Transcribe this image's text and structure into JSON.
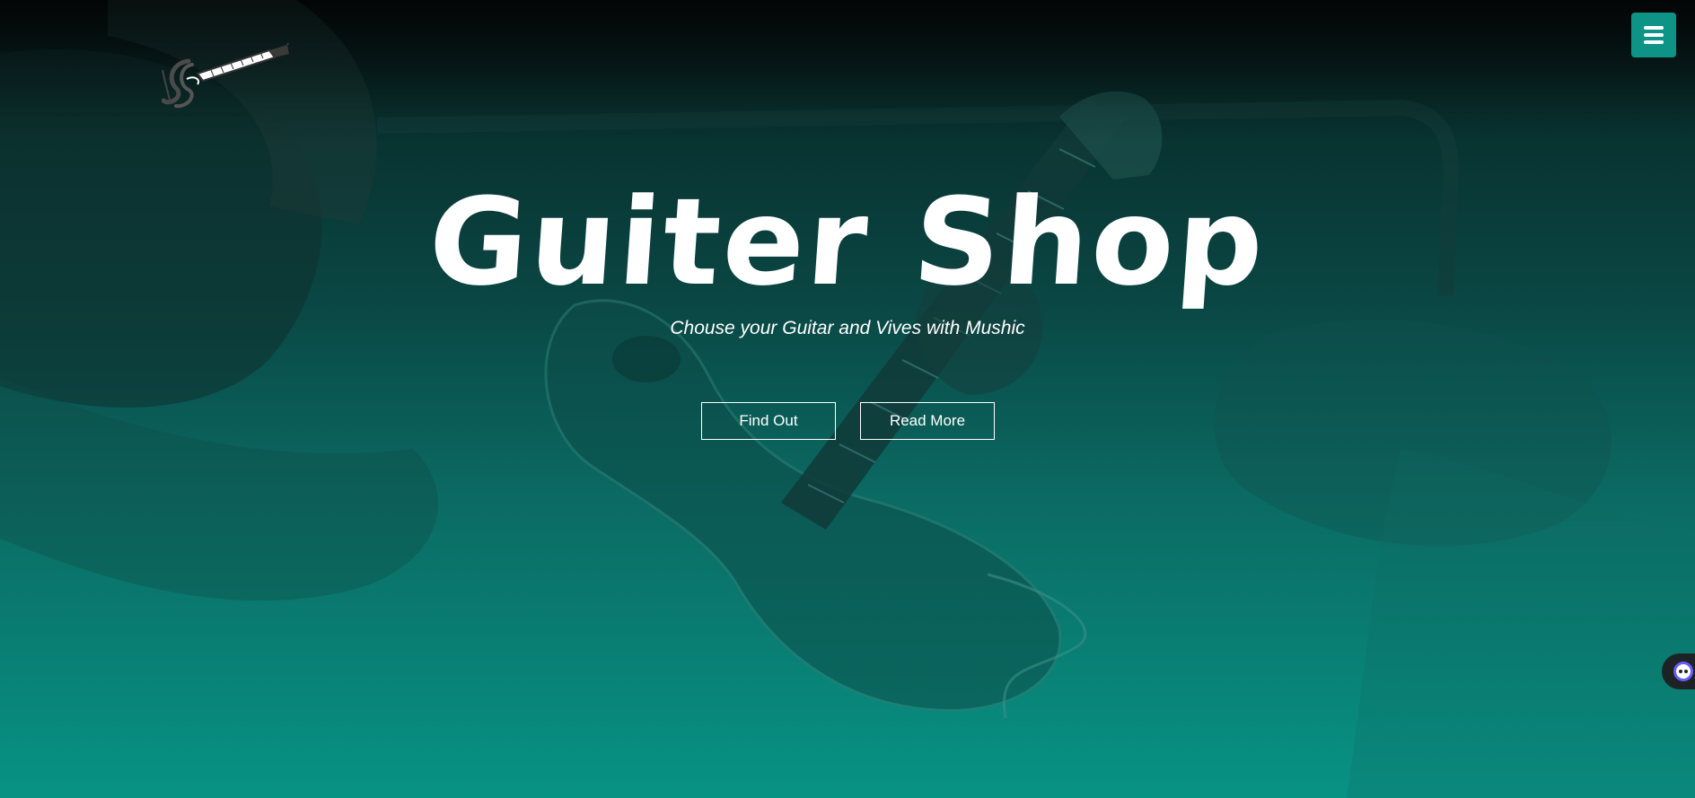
{
  "hero": {
    "title": "Guiter Shop",
    "subtitle": "Chouse your Guitar and Vives with Mushic"
  },
  "buttons": {
    "find_out": "Find Out",
    "read_more": "Read More"
  },
  "header": {
    "logo_icon": "guitar-logo-icon",
    "menu_icon": "hamburger-menu-icon"
  },
  "widgets": {
    "assistant_icon": "chat-assistant-icon"
  },
  "colors": {
    "accent": "#0e9486",
    "gradient_top": "#070c0c",
    "gradient_bottom": "#079384",
    "text": "#ffffff"
  }
}
